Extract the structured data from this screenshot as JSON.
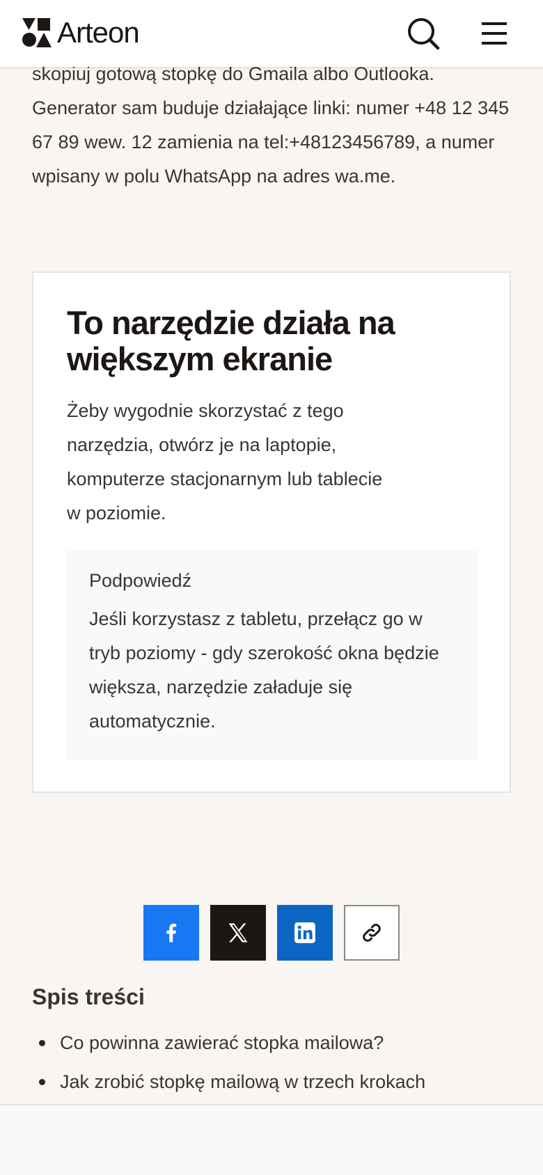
{
  "header": {
    "logo_text": "Arteon",
    "search_icon": "search-icon",
    "menu_icon": "hamburger-menu-icon"
  },
  "intro": {
    "text": "skopiuj gotową stopkę do Gmaila albo Outlooka. Generator sam buduje działające linki: numer +48 12 345 67 89 wew. 12 zamienia na tel:+48123456789, a numer wpisany w polu WhatsApp na adres wa.me."
  },
  "notice": {
    "title": "To narzędzie działa na większym ekranie",
    "text": "Żeby wygodnie skorzystać z tego narzędzia, otwórz je na laptopie, komputerze stacjonarnym lub tablecie w poziomie.",
    "hint_title": "Podpowiedź",
    "hint_text": "Jeśli korzystasz z tabletu, przełącz go w tryb poziomy - gdy szerokość okna będzie większa, narzędzie załaduje się automatycznie."
  },
  "share": {
    "buttons": [
      {
        "icon": "facebook-icon",
        "color": "#1877f2"
      },
      {
        "icon": "x-icon",
        "color": "#1c1714"
      },
      {
        "icon": "linkedin-icon",
        "color": "#0a66c2"
      },
      {
        "icon": "link-icon",
        "color": "#ffffff"
      }
    ]
  },
  "toc": {
    "title": "Spis treści",
    "items": [
      "Co powinna zawierać stopka mailowa?",
      "Jak zrobić stopkę mailową w trzech krokach"
    ]
  },
  "colors": {
    "background": "#f8f5f3",
    "text": "#3a3531",
    "heading": "#1c1714"
  }
}
